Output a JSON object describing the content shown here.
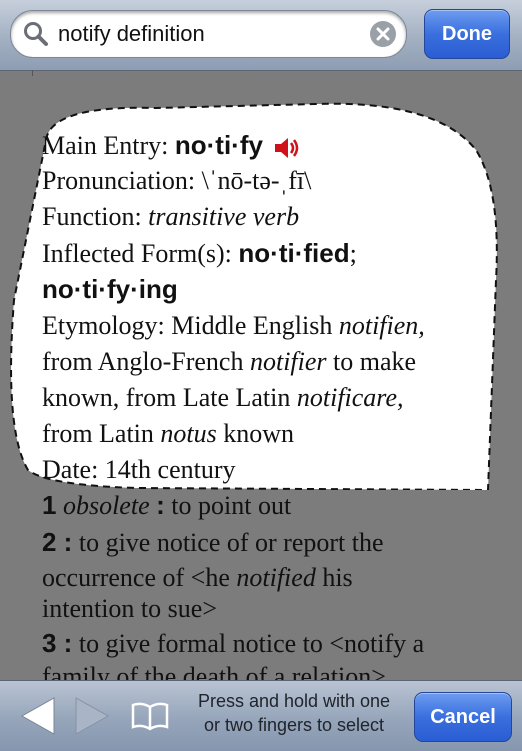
{
  "search": {
    "value": "notify definition",
    "done_label": "Done"
  },
  "entry": {
    "main_entry_label": "Main Entry:",
    "main_entry_word": "no·ti·fy",
    "pronunciation_label": "Pronunciation:",
    "pronunciation_value": "\\ˈnō-tə-ˌfī\\",
    "function_label": "Function:",
    "function_value": "transitive verb",
    "inflected_label": "Inflected Form(s):",
    "inflected_form_1": "no·ti·fied",
    "inflected_sep": ";",
    "inflected_form_2": "no·ti·fy·ing",
    "etym_label": "Etymology: Middle English",
    "etym_1": "notifien,",
    "etym_2": "from Anglo-French",
    "etym_3": "notifier",
    "etym_4": "to make",
    "etym_5": "known, from Late Latin",
    "etym_6": "notificare,",
    "etym_7": "from Latin",
    "etym_8": "notus",
    "etym_9": "known",
    "date_label": "Date: 14th century"
  },
  "senses": {
    "s1_num": "1",
    "s1_label": "obsolete",
    "s1_colon": ":",
    "s1_text": "to point out",
    "s2_num": "2 :",
    "s2_text": "to give notice of or report the",
    "s2_text_b": "occurrence of <he",
    "s2_italic": "notified",
    "s2_text_c": "his",
    "s2_text_d": "intention to sue>",
    "s3_num": "3 :",
    "s3_text": "to give formal notice to <notify a",
    "s3_text_b": "family of the death of a relation>"
  },
  "toolbar": {
    "hint_line1": "Press and hold with one",
    "hint_line2": "or two fingers to select",
    "cancel_label": "Cancel"
  },
  "icons": {
    "search": "search-icon",
    "clear": "clear-icon",
    "speaker": "speaker-icon",
    "back": "back-arrow-icon",
    "forward": "forward-arrow-icon",
    "bookmarks": "book-icon"
  }
}
